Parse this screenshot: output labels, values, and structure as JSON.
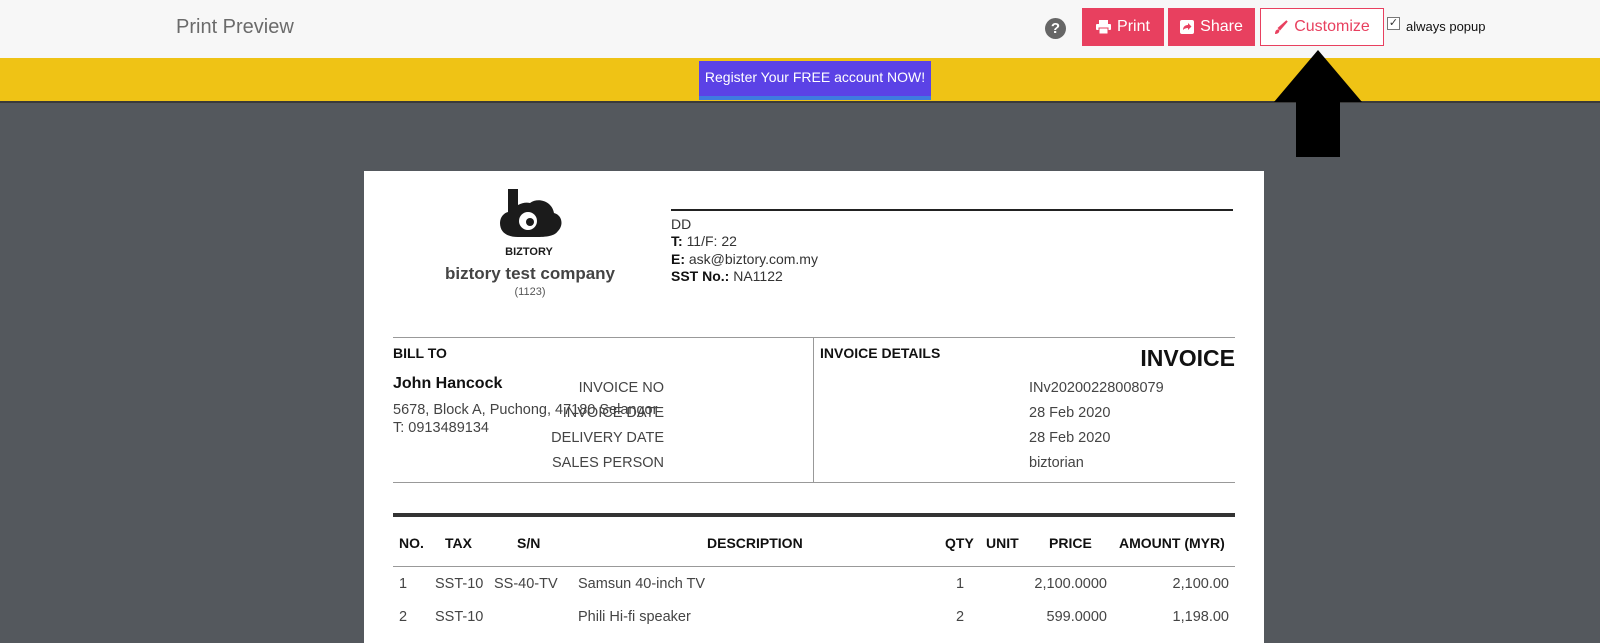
{
  "toolbar": {
    "title": "Print Preview",
    "help_glyph": "?",
    "print_label": "Print",
    "share_label": "Share",
    "customize_label": "Customize",
    "always_popup_label": "always popup",
    "always_popup_checked": true,
    "accent_color": "#e8405f"
  },
  "banner": {
    "register_label": "Register Your FREE account NOW!",
    "background_color": "#efc315"
  },
  "company": {
    "logo_text": "BIZTORY",
    "name": "biztory test company",
    "reg_no": "(1123)",
    "address_line": "DD",
    "tel_label": "T:",
    "tel_value": "11/F: 22",
    "email_label": "E:",
    "email_value": "ask@biztory.com.my",
    "sst_label": "SST No.:",
    "sst_value": "NA1122"
  },
  "bill_to": {
    "heading": "BILL TO",
    "name": "John Hancock",
    "address": "5678, Block A, Puchong, 47180 Selangor",
    "phone": "T: 0913489134"
  },
  "invoice_details": {
    "heading": "INVOICE DETAILS",
    "doc_title": "INVOICE",
    "rows": [
      {
        "label": "INVOICE NO",
        "value": "INv20200228008079"
      },
      {
        "label": "INVOICE DATE",
        "value": "28 Feb 2020"
      },
      {
        "label": "DELIVERY DATE",
        "value": "28 Feb 2020"
      },
      {
        "label": "SALES PERSON",
        "value": "biztorian"
      }
    ]
  },
  "items_table": {
    "headers": [
      "NO.",
      "TAX",
      "S/N",
      "DESCRIPTION",
      "QTY",
      "UNIT",
      "PRICE",
      "AMOUNT (MYR)"
    ],
    "rows": [
      {
        "no": "1",
        "tax": "SST-10",
        "sn": "SS-40-TV",
        "description": "Samsun 40-inch TV",
        "qty": "1",
        "unit": "",
        "price": "2,100.0000",
        "amount": "2,100.00"
      },
      {
        "no": "2",
        "tax": "SST-10",
        "sn": "",
        "description": "Phili Hi-fi speaker",
        "qty": "2",
        "unit": "",
        "price": "599.0000",
        "amount": "1,198.00"
      }
    ]
  },
  "icons": {
    "help": "help-circle-icon",
    "print": "printer-icon",
    "share": "share-icon",
    "customize": "paintbrush-icon",
    "pointer": "up-arrow-icon"
  }
}
